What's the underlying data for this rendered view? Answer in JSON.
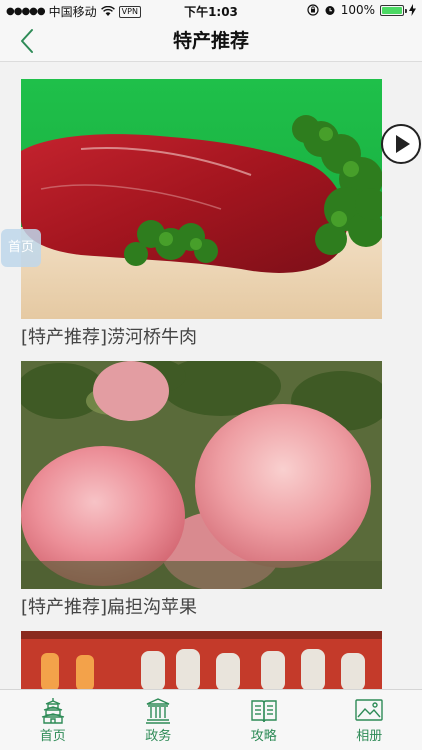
{
  "status_bar": {
    "carrier": "中国移动",
    "vpn": "VPN",
    "time": "下午1:03",
    "battery": "100%"
  },
  "nav": {
    "title": "特产推荐"
  },
  "items": [
    {
      "title": "[特产推荐]涝河桥牛肉"
    },
    {
      "title": "[特产推荐]扁担沟苹果"
    }
  ],
  "float": {
    "home_label": "首页"
  },
  "tab_bar": {
    "tabs": [
      {
        "label": "首页",
        "icon": "pagoda-icon"
      },
      {
        "label": "政务",
        "icon": "government-building-icon"
      },
      {
        "label": "攻略",
        "icon": "open-book-icon"
      },
      {
        "label": "相册",
        "icon": "photo-album-icon"
      }
    ],
    "accent": "#2e8b57"
  }
}
